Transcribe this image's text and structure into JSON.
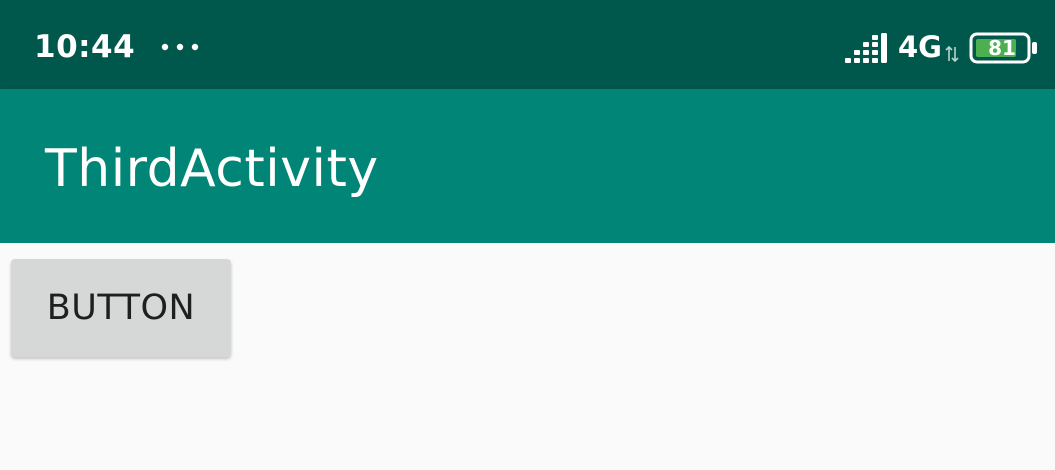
{
  "status_bar": {
    "time": "10:44",
    "more_icon": "three-dots-icon",
    "signal_icon": "signal-strength-icon",
    "network_type": "4G",
    "data_activity_icon": "data-transfer-arrows-icon",
    "battery_icon": "battery-icon",
    "battery_level": "81",
    "battery_color": "#4caf50",
    "background_color": "#00574b"
  },
  "app_bar": {
    "title": "ThirdActivity",
    "background_color": "#008577"
  },
  "content": {
    "button_label": "BUTTON",
    "button_color": "#d6d7d7"
  }
}
